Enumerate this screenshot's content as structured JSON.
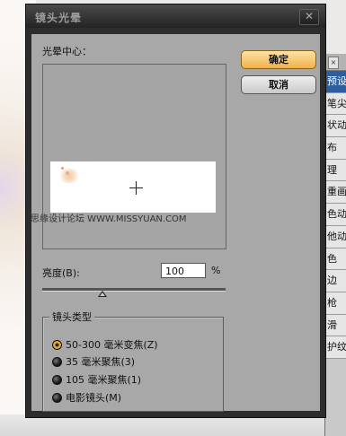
{
  "dialog": {
    "title": "镜头光晕",
    "close_glyph": "✕"
  },
  "preview": {
    "label": "光晕中心："
  },
  "buttons": {
    "ok": "确定",
    "cancel": "取消"
  },
  "watermark": "思缘设计论坛 WWW.MISSYUAN.COM",
  "brightness": {
    "label": "亮度(B):",
    "value": "100",
    "unit": "%",
    "slider_fraction": 0.33
  },
  "lens_type": {
    "legend": "镜头类型",
    "options": [
      {
        "label": "50-300 毫米变焦(Z)",
        "selected": true
      },
      {
        "label": "35 毫米聚焦(3)",
        "selected": false
      },
      {
        "label": "105 毫米聚焦(1)",
        "selected": false
      },
      {
        "label": "电影镜头(M)",
        "selected": false
      }
    ]
  },
  "side_panel": {
    "tab_glyph": "×",
    "rows": [
      "预设",
      "笔尖",
      "状动",
      "布",
      "理",
      "重画",
      "色动",
      "他动",
      "色",
      "边",
      "枪",
      "滑",
      "护纹"
    ]
  },
  "colors": {
    "dialog_body": "#a8a8a8",
    "ok_button": "#f0b14a",
    "titlebar": "#2d2d2d"
  }
}
